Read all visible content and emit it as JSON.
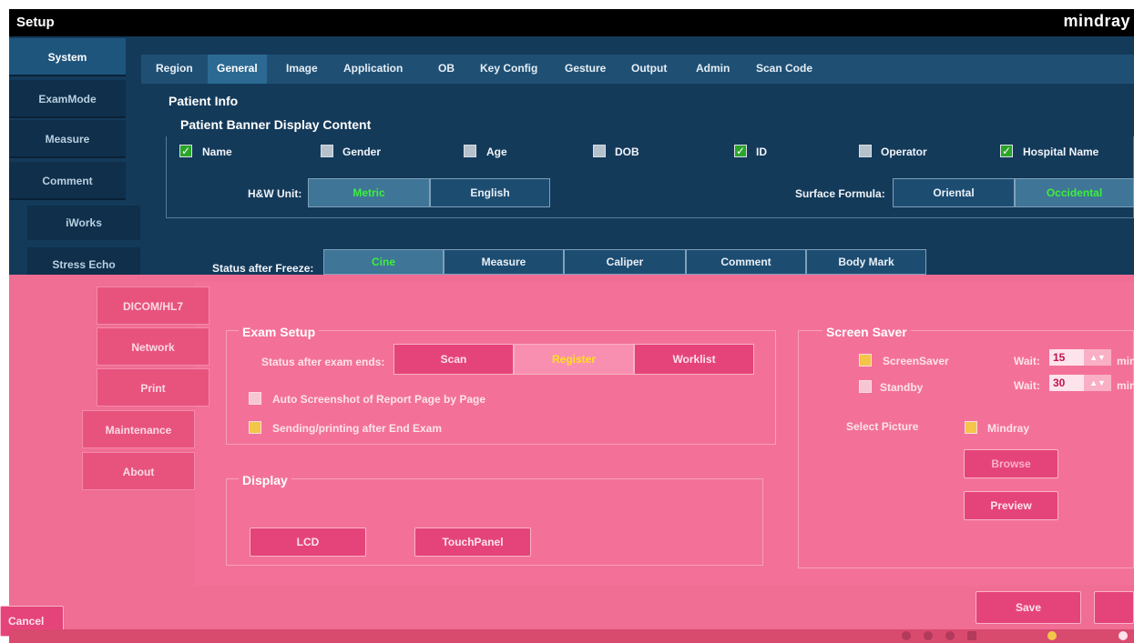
{
  "window": {
    "title": "Setup",
    "brand": "mindray"
  },
  "tabs": [
    {
      "label": "Region",
      "active": false
    },
    {
      "label": "General",
      "active": true
    },
    {
      "label": "Image",
      "active": false
    },
    {
      "label": "Application",
      "active": false
    },
    {
      "label": "OB",
      "active": false
    },
    {
      "label": "Key Config",
      "active": false
    },
    {
      "label": "Gesture",
      "active": false
    },
    {
      "label": "Output",
      "active": false
    },
    {
      "label": "Admin",
      "active": false
    },
    {
      "label": "Scan Code",
      "active": false
    }
  ],
  "nav": {
    "system": "System",
    "exammode": "ExamMode",
    "measure": "Measure",
    "comment": "Comment",
    "iworks": "iWorks",
    "stressecho": "Stress Echo",
    "dicom": "DICOM/HL7",
    "network": "Network",
    "print": "Print",
    "maintenance": "Maintenance",
    "about": "About"
  },
  "patient_info": {
    "legend": "Patient Info",
    "banner_legend": "Patient Banner Display Content",
    "checkboxes": {
      "name": {
        "label": "Name",
        "checked": true
      },
      "gender": {
        "label": "Gender",
        "checked": false
      },
      "age": {
        "label": "Age",
        "checked": false
      },
      "dob": {
        "label": "DOB",
        "checked": false
      },
      "id": {
        "label": "ID",
        "checked": true
      },
      "operator": {
        "label": "Operator",
        "checked": false
      },
      "hospital": {
        "label": "Hospital Name",
        "checked": true
      }
    },
    "hw_unit": {
      "label": "H&W Unit:",
      "metric": "Metric",
      "english": "English",
      "selected": "Metric"
    },
    "surface_formula": {
      "label": "Surface Formula:",
      "oriental": "Oriental",
      "occidental": "Occidental",
      "selected": "Occidental"
    },
    "status_freeze": {
      "label": "Status after Freeze:",
      "cine": "Cine",
      "measure": "Measure",
      "caliper": "Caliper",
      "comment": "Comment",
      "bodymark": "Body Mark",
      "selected": "Cine"
    }
  },
  "exam_setup": {
    "legend": "Exam Setup",
    "status_label": "Status after exam ends:",
    "scan": "Scan",
    "register": "Register",
    "worklist": "Worklist",
    "selected": "Register",
    "auto_screenshot": {
      "label": "Auto Screenshot of Report Page by Page",
      "checked": false
    },
    "sending": {
      "label": "Sending/printing after End Exam",
      "checked": true
    }
  },
  "display": {
    "legend": "Display",
    "lcd": "LCD",
    "touchpanel": "TouchPanel"
  },
  "screen_saver": {
    "legend": "Screen Saver",
    "screensaver": {
      "label": "ScreenSaver",
      "checked": true,
      "wait_label": "Wait:",
      "wait_value": "15",
      "unit": "min"
    },
    "standby": {
      "label": "Standby",
      "checked": false,
      "wait_label": "Wait:",
      "wait_value": "30",
      "unit": "min"
    },
    "select_picture": "Select Picture",
    "mindray": {
      "label": "Mindray",
      "checked": true
    },
    "browse": "Browse",
    "preview": "Preview"
  },
  "footer": {
    "cancel": "Cancel",
    "save": "Save"
  },
  "colors": {
    "blue_bg": "#143a5a",
    "pink_bg": "#f06d93",
    "accent_green": "#3cf03c",
    "accent_yellow": "#ffe11a"
  }
}
